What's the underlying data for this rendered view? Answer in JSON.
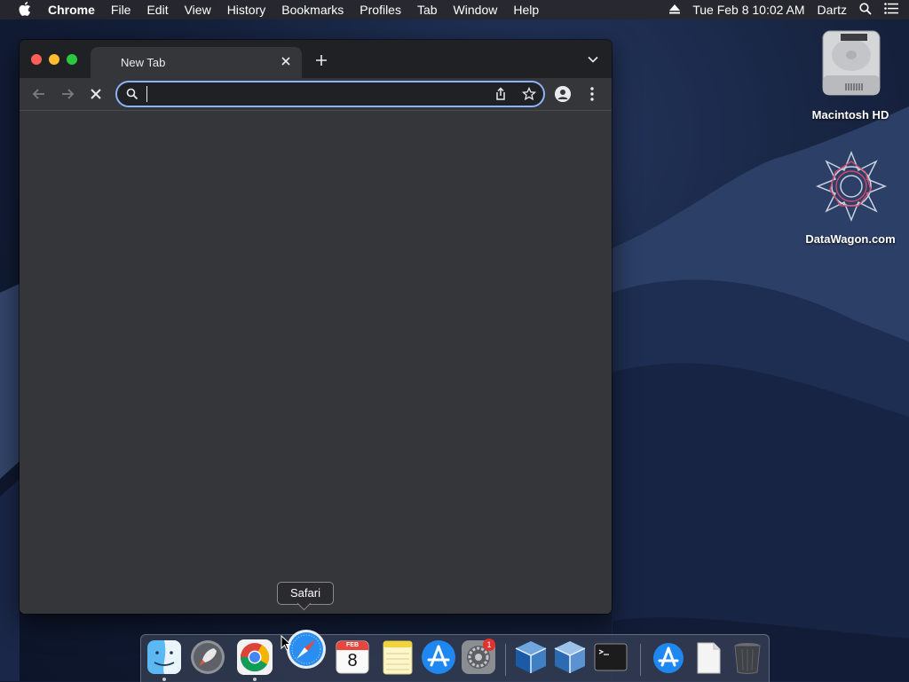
{
  "menubar": {
    "app_name": "Chrome",
    "items": [
      "File",
      "Edit",
      "View",
      "History",
      "Bookmarks",
      "Profiles",
      "Tab",
      "Window",
      "Help"
    ],
    "clock": "Tue Feb 8  10:02 AM",
    "user": "Dartz"
  },
  "browser": {
    "tab_title": "New Tab",
    "omnibox_value": "",
    "accent": "#8ab4f8"
  },
  "desktop": {
    "icons": [
      {
        "label": "Macintosh HD",
        "icon": "hard-drive-icon"
      },
      {
        "label": "DataWagon.com",
        "icon": "datawagon-logo-icon"
      }
    ]
  },
  "tooltip": "Safari",
  "dock": {
    "apps": [
      "Finder",
      "Launchpad",
      "Google Chrome",
      "Safari",
      "Calendar",
      "Notes",
      "App Store",
      "System Preferences",
      "VirtualBox",
      "VirtualBox VM",
      "Terminal",
      "App Store Downloads",
      "Document",
      "Trash"
    ],
    "calendar_month": "FEB",
    "calendar_day": "8",
    "prefs_badge": "1"
  }
}
